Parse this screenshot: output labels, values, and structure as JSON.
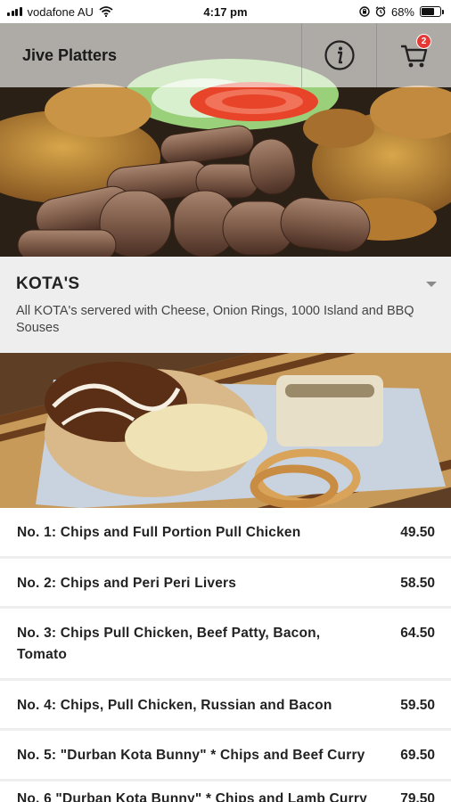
{
  "status_bar": {
    "carrier": "vodafone AU",
    "time": "4:17 pm",
    "battery": "68%",
    "battery_level": 0.68
  },
  "header": {
    "title": "Jive Platters",
    "info_icon": "info-icon",
    "cart_icon": "cart-icon",
    "cart_count": "2"
  },
  "category": {
    "title": "KOTA'S",
    "description": "All KOTA's servered with Cheese, Onion Rings, 1000 Island and BBQ Souses",
    "expand_icon": "caret-down-icon"
  },
  "menu": {
    "items": [
      {
        "name": "No. 1: Chips and Full Portion Pull Chicken",
        "price": "49.50"
      },
      {
        "name": "No. 2: Chips and Peri Peri Livers",
        "price": "58.50"
      },
      {
        "name": "No. 3: Chips Pull Chicken, Beef Patty, Bacon, Tomato",
        "price": "64.50"
      },
      {
        "name": "No. 4: Chips, Pull Chicken, Russian and Bacon",
        "price": "59.50"
      },
      {
        "name": "No. 5: \"Durban Kota Bunny\" * Chips and Beef Curry",
        "price": "69.50"
      },
      {
        "name": "No. 6 \"Durban Kota Bunny\" * Chips and Lamb Curry",
        "price": "79.50"
      }
    ]
  },
  "colors": {
    "badge": "#e53935",
    "category_bg": "#eeeeee",
    "divider": "#eeeeee"
  }
}
